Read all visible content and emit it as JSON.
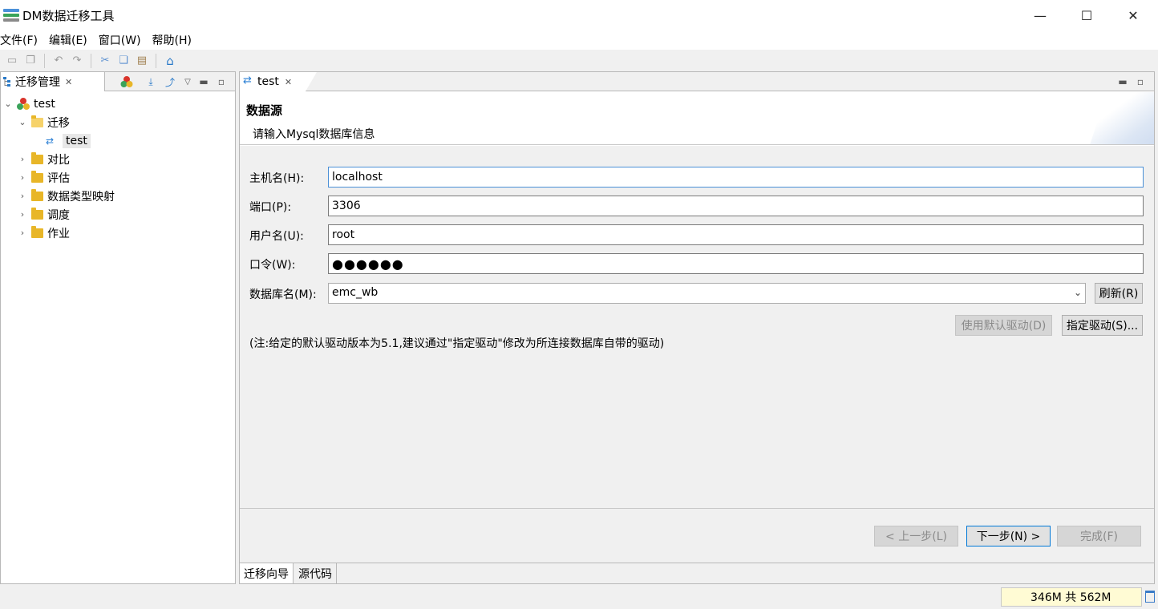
{
  "window": {
    "title": "DM数据迁移工具",
    "minimize_glyph": "—",
    "maximize_glyph": "☐",
    "close_glyph": "✕"
  },
  "menu": [
    "文件(F)",
    "编辑(E)",
    "窗口(W)",
    "帮助(H)"
  ],
  "toolbar": {
    "icons": [
      "save-icon",
      "save-all-icon",
      "undo-icon",
      "redo-icon",
      "cut-icon",
      "copy-icon",
      "paste-icon",
      "home-icon"
    ]
  },
  "left_panel": {
    "tab_label": "迁移管理",
    "close_glyph": "✕",
    "tree": {
      "project": "test",
      "folders": [
        {
          "label": "迁移",
          "expanded": true,
          "children": [
            "test"
          ]
        },
        {
          "label": "对比",
          "expanded": false
        },
        {
          "label": "评估",
          "expanded": false
        },
        {
          "label": "数据类型映射",
          "expanded": false
        },
        {
          "label": "调度",
          "expanded": false
        },
        {
          "label": "作业",
          "expanded": false
        }
      ]
    }
  },
  "editor": {
    "tab_label": "test",
    "close_glyph": "✕",
    "wizard_title": "数据源",
    "wizard_description": "请输入Mysql数据库信息",
    "fields": {
      "host": {
        "label": "主机名(H):",
        "value": "localhost"
      },
      "port": {
        "label": "端口(P):",
        "value": "3306"
      },
      "user": {
        "label": "用户名(U):",
        "value": "root"
      },
      "password": {
        "label": "口令(W):",
        "value": "●●●●●●"
      },
      "database": {
        "label": "数据库名(M):",
        "value": "emc_wb"
      }
    },
    "buttons": {
      "refresh": "刷新(R)",
      "default_driver": "使用默认驱动(D)",
      "specify_driver": "指定驱动(S)...",
      "back": "< 上一步(L)",
      "next": "下一步(N) >",
      "finish": "完成(F)"
    },
    "note": "(注:给定的默认驱动版本为5.1,建议通过\"指定驱动\"修改为所连接数据库自带的驱动)",
    "bottom_tabs": [
      "迁移向导",
      "源代码"
    ]
  },
  "status": {
    "heap": "346M 共 562M"
  },
  "colors": {
    "accent": "#2979c8",
    "focus_border": "#4a8fd6",
    "heap_background": "#fffbd4"
  }
}
